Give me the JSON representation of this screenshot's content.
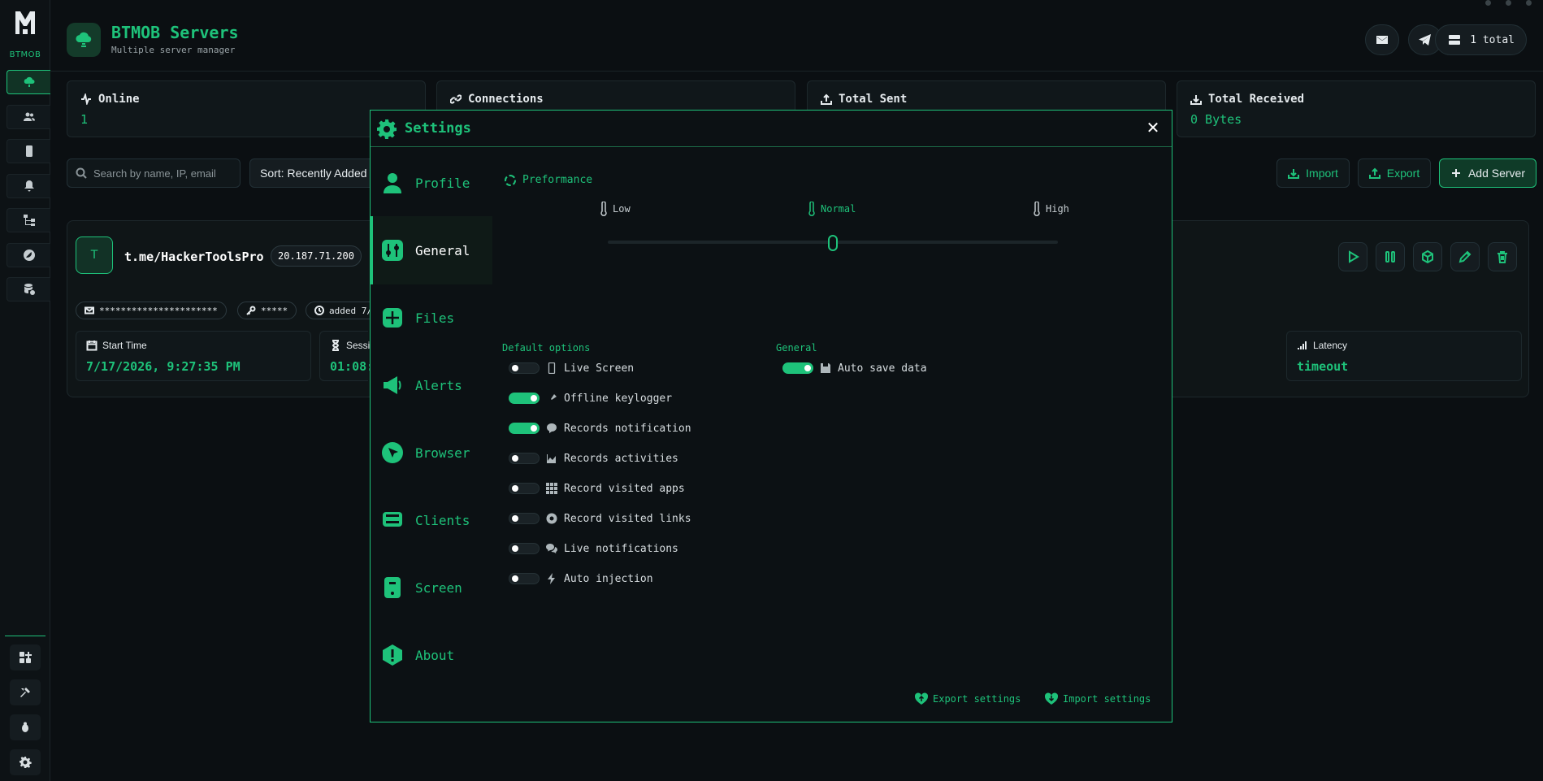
{
  "rail": {
    "brand": "BTMOB"
  },
  "header": {
    "title": "BTMOB Servers",
    "subtitle": "Multiple server manager",
    "total_label": "1 total"
  },
  "stats": [
    {
      "label": "Online",
      "value": "1"
    },
    {
      "label": "Connections",
      "value": ""
    },
    {
      "label": "Total Sent",
      "value": ""
    },
    {
      "label": "Total Received",
      "value": "0 Bytes"
    }
  ],
  "toolbar": {
    "search_placeholder": "Search by name, IP, email",
    "sort_label": "Sort: Recently Added",
    "import_label": "Import",
    "export_label": "Export",
    "add_label": "Add Server"
  },
  "server": {
    "avatar_letter": "T",
    "name": "t.me/HackerToolsPro",
    "ip": "20.187.71.200",
    "email_masked": "**********************",
    "password_masked": "*****",
    "added": "added 7/",
    "start_time_label": "Start Time",
    "start_time_value": "7/17/2026, 9:27:35 PM",
    "session_label": "Sessi",
    "session_value": "01:08:",
    "latency_label": "Latency",
    "latency_value": "timeout"
  },
  "settings": {
    "title": "Settings",
    "close": "✕",
    "nav": [
      {
        "label": "Profile"
      },
      {
        "label": "General"
      },
      {
        "label": "Files"
      },
      {
        "label": "Alerts"
      },
      {
        "label": "Browser"
      },
      {
        "label": "Clients"
      },
      {
        "label": "Screen"
      },
      {
        "label": "About"
      }
    ],
    "active_nav": "General",
    "performance": {
      "title": "Preformance",
      "levels": [
        "Low",
        "Normal",
        "High"
      ],
      "selected": "Normal"
    },
    "default_options_title": "Default options",
    "default_options": [
      {
        "label": "Live Screen",
        "enabled": false
      },
      {
        "label": "Offline keylogger",
        "enabled": true
      },
      {
        "label": "Records notification",
        "enabled": true
      },
      {
        "label": "Records activities",
        "enabled": false
      },
      {
        "label": "Record visited apps",
        "enabled": false
      },
      {
        "label": "Record visited links",
        "enabled": false
      },
      {
        "label": "Live notifications",
        "enabled": false
      },
      {
        "label": "Auto injection",
        "enabled": false
      }
    ],
    "general_title": "General",
    "general_options": [
      {
        "label": "Auto save data",
        "enabled": true
      }
    ],
    "export_settings": "Export settings",
    "import_settings": "Import settings"
  },
  "colors": {
    "accent": "#1ec27a",
    "background": "#0b0f12",
    "panel": "#10171a"
  }
}
